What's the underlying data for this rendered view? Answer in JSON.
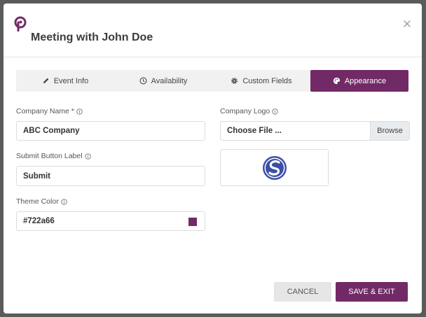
{
  "dialog": {
    "title": "Meeting with John Doe",
    "close_icon": "close-icon",
    "logo_icon": "brand-logo-icon"
  },
  "tabs": [
    {
      "label": "Event Info",
      "icon": "pencil-icon",
      "active": false
    },
    {
      "label": "Availability",
      "icon": "clock-icon",
      "active": false
    },
    {
      "label": "Custom Fields",
      "icon": "gear-icon",
      "active": false
    },
    {
      "label": "Appearance",
      "icon": "palette-icon",
      "active": true
    }
  ],
  "form": {
    "company_name": {
      "label": "Company Name *",
      "value": "ABC Company"
    },
    "submit_label": {
      "label": "Submit Button Label",
      "value": "Submit"
    },
    "theme_color": {
      "label": "Theme Color",
      "value": "#722a66"
    },
    "company_logo": {
      "label": "Company Logo",
      "value": "Choose File ...",
      "browse": "Browse"
    }
  },
  "footer": {
    "cancel": "CANCEL",
    "save": "SAVE & EXIT"
  },
  "colors": {
    "accent": "#722a66",
    "logo_blue": "#3a4fa8"
  }
}
